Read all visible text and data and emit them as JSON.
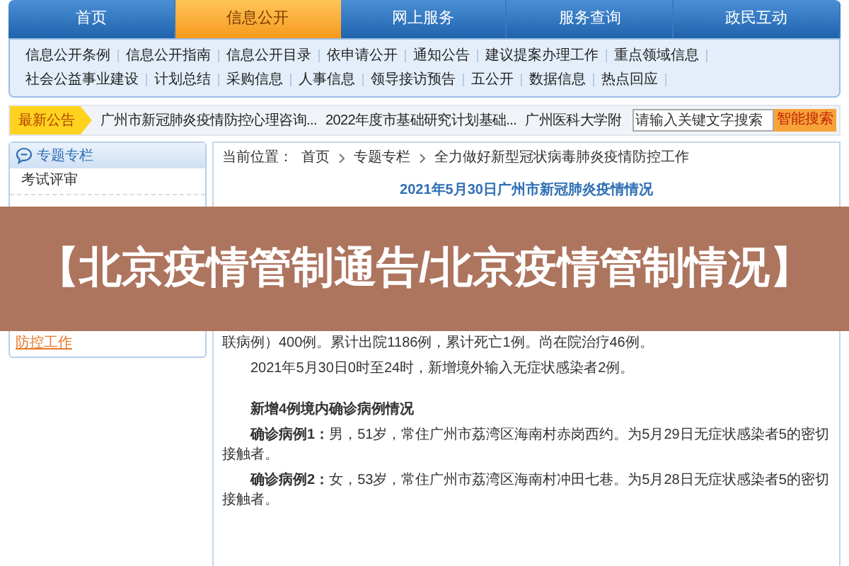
{
  "nav_tabs": [
    {
      "label": "首页",
      "selected": false
    },
    {
      "label": "信息公开",
      "selected": true
    },
    {
      "label": "网上服务",
      "selected": false
    },
    {
      "label": "服务查询",
      "selected": false
    },
    {
      "label": "政民互动",
      "selected": false
    }
  ],
  "sub_menu": [
    "信息公开条例",
    "信息公开指南",
    "信息公开目录",
    "依申请公开",
    "通知公告",
    "建议提案办理工作",
    "重点领域信息",
    "社会公益事业建设",
    "计划总结",
    "采购信息",
    "人事信息",
    "领导接访预告",
    "五公开",
    "数据信息",
    "热点回应"
  ],
  "notice_bar": {
    "label": "最新公告",
    "items": [
      "广州市新冠肺炎疫情防控心理咨询...",
      "2022年度市基础研究计划基础...",
      "广州医科大学附"
    ],
    "search": {
      "placeholder": "请输入关键文字搜索"
    },
    "search_button": "智能搜索"
  },
  "sidebar": {
    "title": "专题专栏",
    "items": [
      {
        "label": "考试评审",
        "selected": false
      }
    ],
    "items_below": [
      {
        "label": "防控工作",
        "selected": true
      }
    ]
  },
  "breadcrumb": {
    "label": "当前位置：",
    "items": [
      "首页",
      "专题专栏",
      "全力做好新型冠状病毒肺炎疫情防控工作"
    ]
  },
  "article": {
    "title": "2021年5月30日广州市新冠肺炎疫情情况",
    "blocks": [
      {
        "kind": "fragment",
        "text": "联病例）400例。累计出院1186例，累计死亡1例。尚在院治疗46例。"
      },
      {
        "kind": "paragraph",
        "text": "2021年5月30日0时至24时，新增境外输入无症状感染者2例。"
      },
      {
        "kind": "heading",
        "text": "新增4例境内确诊病例情况"
      },
      {
        "kind": "paragraph",
        "text": "**确诊病例1：**男，51岁，常住广州市荔湾区海南村赤岗西约。为5月29日无症状感染者5的密切接触者。"
      },
      {
        "kind": "paragraph",
        "text": "**确诊病例2：**女，53岁，常住广州市荔湾区海南村冲田七巷。为5月28日无症状感染者5的密切接触者。"
      }
    ]
  },
  "banner": {
    "text": "【北京疫情管制通告/北京疫情管制情况】"
  }
}
